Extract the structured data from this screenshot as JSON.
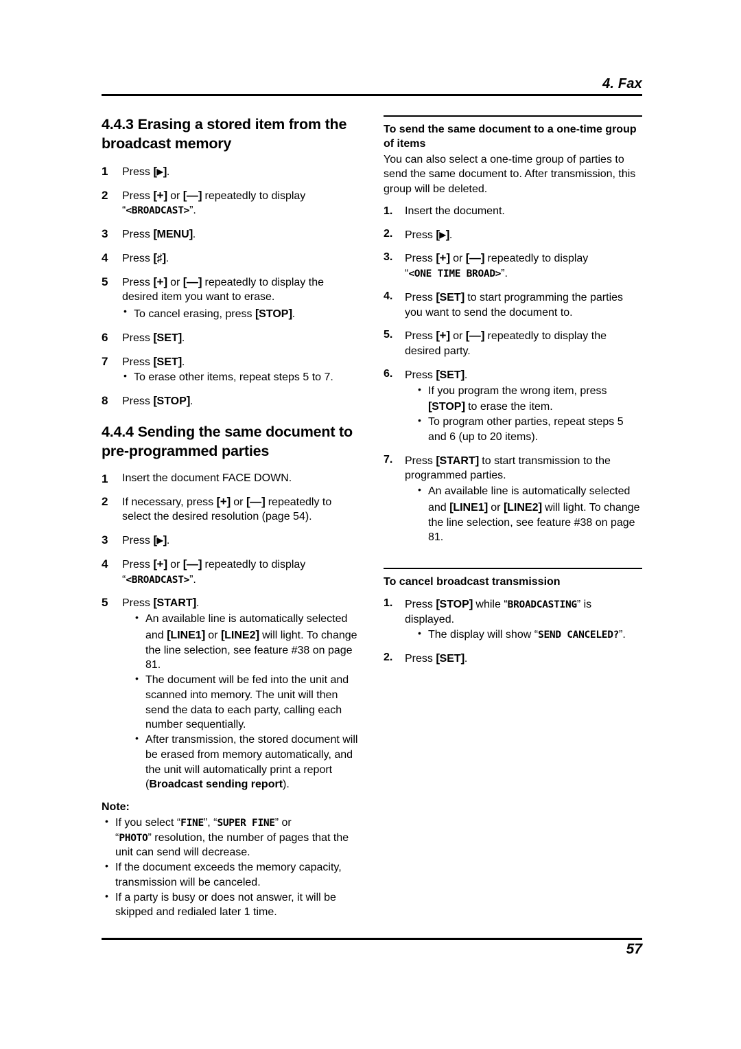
{
  "header": {
    "chapter_title": "4. Fax"
  },
  "footer": {
    "page_number": "57"
  },
  "left_column": {
    "section_443": {
      "heading": "4.4.3 Erasing a stored item from the broadcast memory",
      "steps": [
        {
          "num": "1",
          "text_pre": "Press ",
          "key": "▶",
          "text_post": "."
        },
        {
          "num": "2",
          "line1_pre": "Press ",
          "key_a": "+",
          "mid": " or ",
          "key_b": "—",
          "line1_post": " repeatedly to display",
          "lcd": "<BROADCAST>"
        },
        {
          "num": "3",
          "text_pre": "Press ",
          "key": "MENU",
          "text_post": "."
        },
        {
          "num": "4",
          "text_pre": "Press ",
          "key": "♯",
          "text_post": "."
        },
        {
          "num": "5",
          "line1_pre": "Press ",
          "key_a": "+",
          "mid": " or ",
          "key_b": "—",
          "line1_post": " repeatedly to display the desired item you want to erase.",
          "bullet_pre": "To cancel erasing, press ",
          "bullet_key": "STOP",
          "bullet_post": "."
        },
        {
          "num": "6",
          "text_pre": "Press ",
          "key": "SET",
          "text_post": "."
        },
        {
          "num": "7",
          "text_pre": "Press ",
          "key": "SET",
          "text_post": ".",
          "bullet": "To erase other items, repeat steps 5 to 7."
        },
        {
          "num": "8",
          "text_pre": "Press ",
          "key": "STOP",
          "text_post": "."
        }
      ]
    },
    "section_444": {
      "heading": "4.4.4 Sending the same document to pre-programmed parties",
      "steps": [
        {
          "num": "1",
          "text": "Insert the document FACE DOWN."
        },
        {
          "num": "2",
          "line1_pre": "If necessary, press ",
          "key_a": "+",
          "mid": " or ",
          "key_b": "—",
          "line1_post": " repeatedly to select the desired resolution (page 54)."
        },
        {
          "num": "3",
          "text_pre": "Press ",
          "key": "▶",
          "text_post": "."
        },
        {
          "num": "4",
          "line1_pre": "Press ",
          "key_a": "+",
          "mid": " or ",
          "key_b": "—",
          "line1_post": " repeatedly to display",
          "lcd": "<BROADCAST>"
        },
        {
          "num": "5",
          "text_pre": "Press ",
          "key": "START",
          "text_post": "."
        }
      ],
      "step5_bullets": [
        {
          "pre": "An available line is automatically selected and ",
          "key_a": "LINE1",
          "mid": " or ",
          "key_b": "LINE2",
          "post": " will light. To change the line selection, see feature #38 on page 81."
        },
        {
          "plain": "The document will be fed into the unit and scanned into memory. The unit will then send the data to each party, calling each number sequentially."
        },
        {
          "pre_plain": "After transmission, the stored document will be erased from memory automatically, and the unit will automatically print a report (",
          "bold": "Broadcast sending report",
          "post_plain": ")."
        }
      ],
      "note_label": "Note:",
      "notes": [
        {
          "pre": "If you select ",
          "lcd_a": "FINE",
          "mid1": ", ",
          "lcd_b": "SUPER FINE",
          "mid2": " or ",
          "lcd_c": "PHOTO",
          "post": " resolution, the number of pages that the unit can send will decrease."
        },
        {
          "plain": "If the document exceeds the memory capacity, transmission will be canceled."
        },
        {
          "plain": "If a party is busy or does not answer, it will be skipped and redialed later 1 time."
        }
      ]
    }
  },
  "right_column": {
    "one_time_group": {
      "heading": "To send the same document to a one-time group of items",
      "intro": "You can also select a one-time group of parties to send the same document to. After transmission, this group will be deleted.",
      "steps": [
        {
          "num": "1.",
          "text": "Insert the document."
        },
        {
          "num": "2.",
          "text_pre": "Press ",
          "key": "▶",
          "text_post": "."
        },
        {
          "num": "3.",
          "line1_pre": "Press ",
          "key_a": "+",
          "mid": " or ",
          "key_b": "—",
          "line1_post": " repeatedly to display",
          "lcd": "<ONE TIME BROAD>"
        },
        {
          "num": "4.",
          "text_pre": "Press ",
          "key": "SET",
          "text_post": " to start programming the parties you want to send the document to."
        },
        {
          "num": "5.",
          "line1_pre": "Press ",
          "key_a": "+",
          "mid": " or ",
          "key_b": "—",
          "line1_post": " repeatedly to display the desired party."
        },
        {
          "num": "6.",
          "text_pre": "Press ",
          "key": "SET",
          "text_post": "."
        },
        {
          "num": "7.",
          "text_pre": "Press ",
          "key": "START",
          "text_post": " to start transmission to the programmed parties."
        }
      ],
      "step6_bullets": [
        {
          "pre": "If you program the wrong item, press ",
          "key": "STOP",
          "post": " to erase the item."
        },
        {
          "plain": "To program other parties, repeat steps 5 and 6 (up to 20 items)."
        }
      ],
      "step7_bullets": [
        {
          "pre": "An available line is automatically selected and ",
          "key_a": "LINE1",
          "mid": " or ",
          "key_b": "LINE2",
          "post": " will light. To change the line selection, see feature #38 on page 81."
        }
      ]
    },
    "cancel_broadcast": {
      "heading": "To cancel broadcast transmission",
      "steps": [
        {
          "num": "1.",
          "pre": "Press ",
          "key": "STOP",
          "mid": " while ",
          "lcd": "BROADCASTING",
          "post": " is displayed.",
          "bullet_pre": "The display will show ",
          "bullet_lcd": "SEND CANCELED?",
          "bullet_post": "."
        },
        {
          "num": "2.",
          "text_pre": "Press ",
          "key": "SET",
          "text_post": "."
        }
      ]
    }
  }
}
